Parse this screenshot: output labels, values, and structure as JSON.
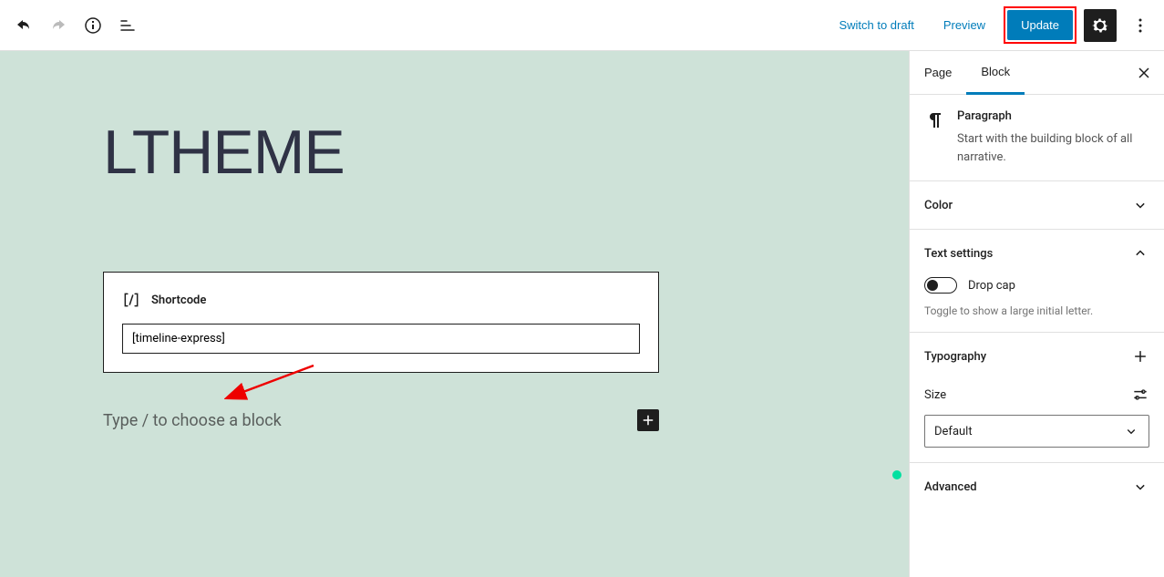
{
  "topbar": {
    "switch_draft": "Switch to draft",
    "preview": "Preview",
    "update": "Update"
  },
  "canvas": {
    "title": "LTHEME",
    "shortcode_block": {
      "label": "Shortcode",
      "value": "[timeline-express]"
    },
    "placeholder": "Type / to choose a block"
  },
  "sidebar": {
    "tabs": {
      "page": "Page",
      "block": "Block"
    },
    "paragraph": {
      "heading": "Paragraph",
      "desc": "Start with the building block of all narrative."
    },
    "color": {
      "title": "Color"
    },
    "text_settings": {
      "title": "Text settings",
      "drop_cap_label": "Drop cap",
      "help": "Toggle to show a large initial letter."
    },
    "typography": {
      "title": "Typography",
      "size_label": "Size",
      "size_value": "Default"
    },
    "advanced": {
      "title": "Advanced"
    }
  }
}
